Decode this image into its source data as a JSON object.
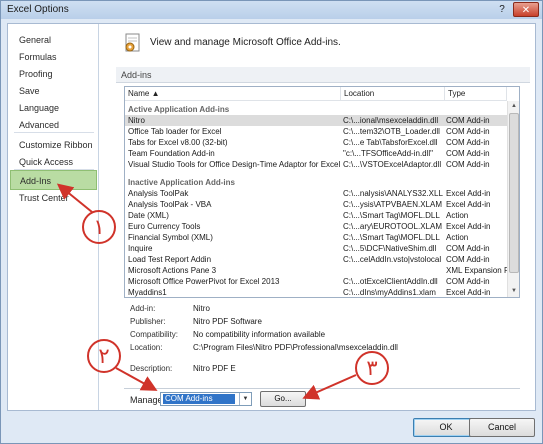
{
  "window": {
    "title": "Excel Options",
    "help_glyph": "?",
    "close_glyph": "✕"
  },
  "sidebar": {
    "items": [
      {
        "label": "General"
      },
      {
        "label": "Formulas"
      },
      {
        "label": "Proofing"
      },
      {
        "label": "Save"
      },
      {
        "label": "Language"
      },
      {
        "label": "Advanced"
      },
      {
        "label": "Customize Ribbon"
      },
      {
        "label": "Quick Access Toolbar"
      },
      {
        "label": "Add-Ins"
      },
      {
        "label": "Trust Center"
      }
    ],
    "active_item": "Add-Ins"
  },
  "main": {
    "header_text": "View and manage Microsoft Office Add-ins.",
    "header_icon": "gear-page-icon",
    "section_title": "Add-ins",
    "columns": [
      "Name ▲",
      "Location",
      "Type"
    ],
    "groups": [
      {
        "title": "Active Application Add-ins",
        "rows": [
          {
            "name": "Nitro",
            "location": "C:\\...ional\\msexceladdin.dll",
            "type": "COM Add-in",
            "selected": true
          },
          {
            "name": "Office Tab loader for Excel",
            "location": "C:\\...tem32\\OTB_Loader.dll",
            "type": "COM Add-in"
          },
          {
            "name": "Tabs for Excel v8.00 (32-bit)",
            "location": "C:\\...e Tab\\TabsforExcel.dll",
            "type": "COM Add-in"
          },
          {
            "name": "Team Foundation Add-in",
            "location": "\"c:\\...TFSOfficeAdd-in.dll\"",
            "type": "COM Add-in"
          },
          {
            "name": "Visual Studio Tools for Office Design-Time Adaptor for Excel",
            "location": "C:\\...\\VSTOExcelAdaptor.dll",
            "type": "COM Add-in"
          }
        ]
      },
      {
        "title": "Inactive Application Add-ins",
        "rows": [
          {
            "name": "Analysis ToolPak",
            "location": "C:\\...nalysis\\ANALYS32.XLL",
            "type": "Excel Add-in"
          },
          {
            "name": "Analysis ToolPak - VBA",
            "location": "C:\\...ysis\\ATPVBAEN.XLAM",
            "type": "Excel Add-in"
          },
          {
            "name": "Date (XML)",
            "location": "C:\\...\\Smart Tag\\MOFL.DLL",
            "type": "Action"
          },
          {
            "name": "Euro Currency Tools",
            "location": "C:\\...ary\\EUROTOOL.XLAM",
            "type": "Excel Add-in"
          },
          {
            "name": "Financial Symbol (XML)",
            "location": "C:\\...\\Smart Tag\\MOFL.DLL",
            "type": "Action"
          },
          {
            "name": "Inquire",
            "location": "C:\\...5\\DCF\\NativeShim.dll",
            "type": "COM Add-in"
          },
          {
            "name": "Load Test Report Addin",
            "location": "C:\\...celAddIn.vsto|vstolocal",
            "type": "COM Add-in"
          },
          {
            "name": "Microsoft Actions Pane 3",
            "location": "",
            "type": "XML Expansion Pack"
          },
          {
            "name": "Microsoft Office PowerPivot for Excel 2013",
            "location": "C:\\...otExcelClientAddIn.dll",
            "type": "COM Add-in"
          },
          {
            "name": "Myaddins1",
            "location": "C:\\...dIns\\myAddins1.xlam",
            "type": "Excel Add-in"
          }
        ]
      }
    ],
    "details": [
      {
        "label": "Add-in:",
        "value": "Nitro"
      },
      {
        "label": "Publisher:",
        "value": "Nitro PDF Software"
      },
      {
        "label": "Compatibility:",
        "value": "No compatibility information available"
      },
      {
        "label": "Location:",
        "value": "C:\\Program Files\\Nitro PDF\\Professional\\msexceladdin.dll"
      },
      {
        "label": "Description:",
        "value": "Nitro PDF E"
      }
    ],
    "manage_label": "Manage:",
    "manage_selected": "COM Add-ins",
    "go_label": "Go..."
  },
  "footer": {
    "ok_label": "OK",
    "cancel_label": "Cancel"
  },
  "annotations": {
    "color": "#d0332a",
    "markers": [
      "١",
      "٢",
      "٣"
    ]
  }
}
